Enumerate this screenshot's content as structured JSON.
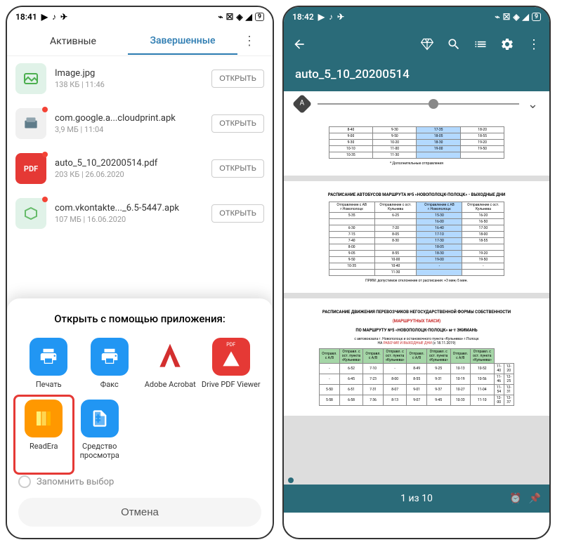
{
  "left": {
    "status": {
      "time": "18:41",
      "battery": "9"
    },
    "tabs": {
      "active_tab": "Активные",
      "done_tab": "Завершенные"
    },
    "files": [
      {
        "name": "Image.jpg",
        "meta": "138 КБ | 11:46",
        "btn": "ОТКРЫТЬ",
        "icon": "image"
      },
      {
        "name": "com.google.a...cloudprint.apk",
        "meta": "3,9 МБ | 11:04",
        "btn": "ОТКРЫТЬ",
        "icon": "apk"
      },
      {
        "name": "auto_5_10_20200514.pdf",
        "meta": "203 КБ | 26.06.2020",
        "btn": "ОТКРЫТЬ",
        "icon": "pdf"
      },
      {
        "name": "com.vkontakte..._6.5-5447.apk",
        "meta": "107 МБ | 16.06.2020",
        "btn": "ОТКРЫТЬ",
        "icon": "apk2"
      }
    ],
    "sheet": {
      "title": "Открыть с помощью приложения:",
      "apps": [
        {
          "label": "Печать"
        },
        {
          "label": "Факс"
        },
        {
          "label": "Adobe Acrobat"
        },
        {
          "label": "Drive PDF Viewer"
        },
        {
          "label": "ReadEra"
        },
        {
          "label": "Средство просмотра"
        }
      ],
      "remember": "Запомнить выбор",
      "cancel": "Отмена"
    }
  },
  "right": {
    "status": {
      "time": "18:42",
      "battery": "9"
    },
    "title": "auto_5_10_20200514",
    "page_counter": "1 из 10",
    "doc": {
      "footnote": "* Дополнительные отправления",
      "heading2": "РАСПИСАНИЕ АВТОБУСОВ МАРШРУТА №5 «НОВОПОЛОЦК-ПОЛОЦК» - ВЫХОДНЫЕ ДНИ",
      "note": "ПРИМ: допустимое отклонение от расписания: +3 мин;-5 мин.",
      "heading3a": "РАСПИСАНИЕ ДВИЖЕНИЯ ПЕРЕВОЗЧИКОВ НЕГОСУДАРСТВЕННОЙ ФОРМЫ СОБСТВЕННОСТИ",
      "heading3b": "(МАРШРУТНЫХ ТАКСИ)",
      "heading3c": "ПО МАРШРУТУ №5 «НОВОПОЛОЦК-ПОЛОЦК» м-т ЭКИМАНЬ"
    }
  }
}
